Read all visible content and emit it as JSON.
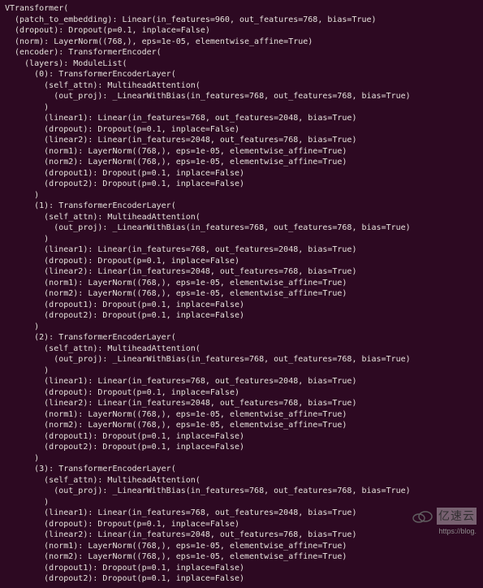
{
  "model": {
    "name": "VTransformer",
    "patch_to_embedding": {
      "type": "Linear",
      "in_features": 960,
      "out_features": 768,
      "bias": true
    },
    "dropout": {
      "type": "Dropout",
      "p": 0.1,
      "inplace": false
    },
    "norm": {
      "type": "LayerNorm",
      "shape": "(768,)",
      "eps": "1e-05",
      "elementwise_affine": true
    },
    "encoder": {
      "type": "TransformerEncoder",
      "layers": {
        "type": "ModuleList",
        "count_shown": 4,
        "layer_template": {
          "type": "TransformerEncoderLayer",
          "self_attn": {
            "type": "MultiheadAttention",
            "out_proj": {
              "type": "_LinearWithBias",
              "in_features": 768,
              "out_features": 768,
              "bias": true
            }
          },
          "linear1": {
            "type": "Linear",
            "in_features": 768,
            "out_features": 2048,
            "bias": true
          },
          "dropout": {
            "type": "Dropout",
            "p": 0.1,
            "inplace": false
          },
          "linear2": {
            "type": "Linear",
            "in_features": 2048,
            "out_features": 768,
            "bias": true
          },
          "norm1": {
            "type": "LayerNorm",
            "shape": "(768,)",
            "eps": "1e-05",
            "elementwise_affine": true
          },
          "norm2": {
            "type": "LayerNorm",
            "shape": "(768,)",
            "eps": "1e-05",
            "elementwise_affine": true
          },
          "dropout1": {
            "type": "Dropout",
            "p": 0.1,
            "inplace": false
          },
          "dropout2": {
            "type": "Dropout",
            "p": 0.1,
            "inplace": false
          }
        }
      }
    }
  },
  "lines": {
    "l0": "VTransformer(",
    "l1": "  (patch_to_embedding): Linear(in_features=960, out_features=768, bias=True)",
    "l2": "  (dropout): Dropout(p=0.1, inplace=False)",
    "l3": "  (norm): LayerNorm((768,), eps=1e-05, elementwise_affine=True)",
    "l4": "  (encoder): TransformerEncoder(",
    "l5": "    (layers): ModuleList(",
    "l6a": "      (0): TransformerEncoderLayer(",
    "l6b": "      (1): TransformerEncoderLayer(",
    "l6c": "      (2): TransformerEncoderLayer(",
    "l6d": "      (3): TransformerEncoderLayer(",
    "l7": "        (self_attn): MultiheadAttention(",
    "l8": "          (out_proj): _LinearWithBias(in_features=768, out_features=768, bias=True)",
    "l9": "        )",
    "l10": "        (linear1): Linear(in_features=768, out_features=2048, bias=True)",
    "l11": "        (dropout): Dropout(p=0.1, inplace=False)",
    "l12": "        (linear2): Linear(in_features=2048, out_features=768, bias=True)",
    "l13": "        (norm1): LayerNorm((768,), eps=1e-05, elementwise_affine=True)",
    "l14": "        (norm2): LayerNorm((768,), eps=1e-05, elementwise_affine=True)",
    "l15": "        (dropout1): Dropout(p=0.1, inplace=False)",
    "l16": "        (dropout2): Dropout(p=0.1, inplace=False)",
    "l17": "      )"
  },
  "watermark": {
    "brand": "亿速云",
    "url": "https://blog."
  }
}
